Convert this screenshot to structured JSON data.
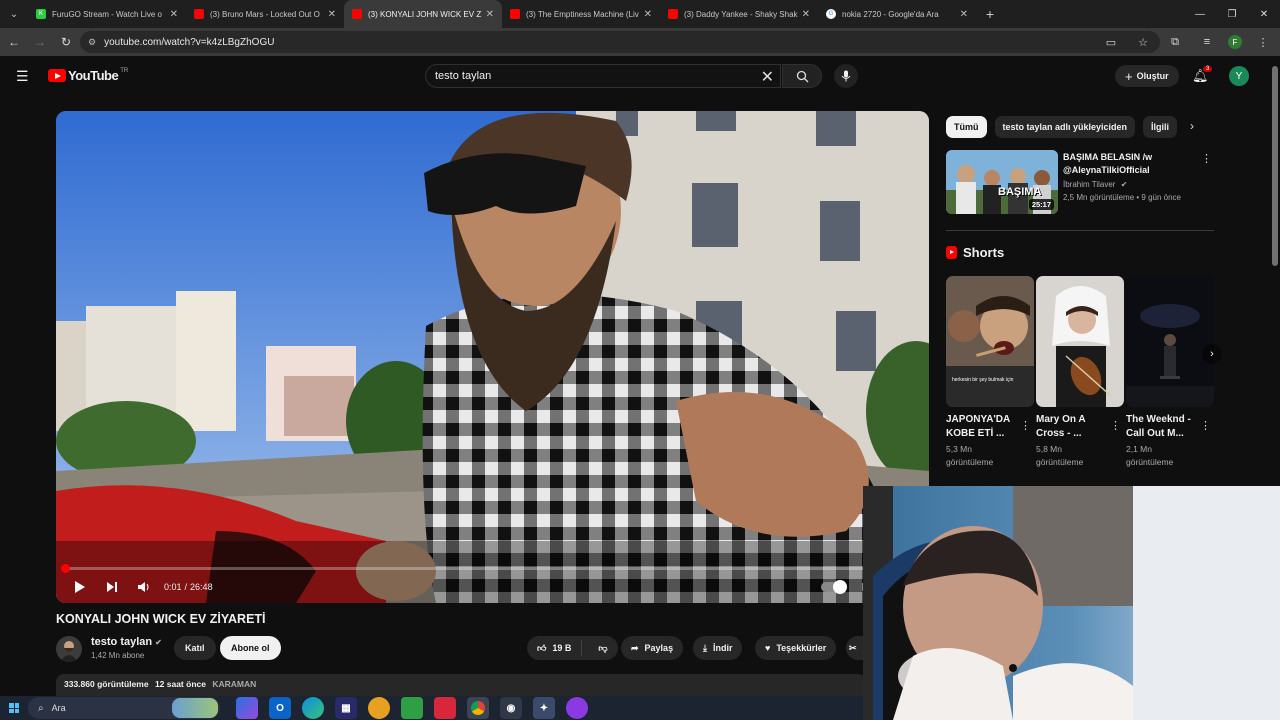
{
  "browser": {
    "tabs": [
      {
        "title": "FuruGO Stream - Watch Live o",
        "favicon_color": "#2ecc40",
        "favicon_letter": "K",
        "active": false
      },
      {
        "title": "(3) Bruno Mars - Locked Out O",
        "favicon_color": "#ff0000",
        "favicon_letter": "▶",
        "active": false
      },
      {
        "title": "(3) KONYALI JOHN WICK EV Zİ",
        "favicon_color": "#ff0000",
        "favicon_letter": "▶",
        "active": true
      },
      {
        "title": "(3) The Emptiness Machine (Liv",
        "favicon_color": "#ff0000",
        "favicon_letter": "▶",
        "active": false
      },
      {
        "title": "(3) Daddy Yankee - Shaky Shak",
        "favicon_color": "#ff0000",
        "favicon_letter": "▶",
        "active": false
      },
      {
        "title": "nokia 2720 - Google'da Ara",
        "favicon_color": "#ffffff",
        "favicon_letter": "G",
        "active": false
      }
    ],
    "url": "youtube.com/watch?v=k4zLBgZhOGU",
    "profile_letter": "F"
  },
  "youtube": {
    "logo_text": "YouTube",
    "logo_region": "TR",
    "search_value": "testo taylan",
    "create_label": "Oluştur",
    "notification_count": "3",
    "avatar_letter": "Y"
  },
  "player": {
    "current_time": "0:01",
    "duration": "26:48",
    "progress": 0.0006
  },
  "video": {
    "title": "KONYALI JOHN WICK EV ZİYARETİ",
    "channel": "testo taylan",
    "subscribers": "1,42 Mn abone",
    "join_label": "Katıl",
    "subscribe_label": "Abone ol",
    "likes": "19 B",
    "share_label": "Paylaş",
    "download_label": "İndir",
    "thanks_label": "Teşekkürler",
    "views": "333.860 görüntüleme",
    "age": "12 saat önce",
    "tag": "KARAMAN"
  },
  "sidebar": {
    "chips": [
      "Tümü",
      "testo taylan adlı yükleyiciden",
      "İlgili"
    ],
    "recommendation": {
      "title_line1": "BAŞIMA BELASIN /w",
      "title_line2": "@AleynaTilkiOfficial",
      "channel": "İbrahim Tilaver",
      "views": "2,5 Mn görüntüleme",
      "age": "9 gün önce",
      "duration": "25:17",
      "thumb_text": "BAŞIMA"
    },
    "shorts_heading": "Shorts",
    "shorts": [
      {
        "title": "JAPONYA'DA KOBE ETİ ...",
        "views_line1": "5,3 Mn",
        "views_line2": "görüntüleme",
        "caption": "herkesin bir şey bulmak için"
      },
      {
        "title": "Mary On A Cross - ...",
        "views_line1": "5,8 Mn",
        "views_line2": "görüntüleme"
      },
      {
        "title": "The Weeknd - Call Out M...",
        "views_line1": "2,1 Mn",
        "views_line2": "görüntüleme"
      }
    ]
  },
  "taskbar": {
    "search_label": "Ara"
  }
}
